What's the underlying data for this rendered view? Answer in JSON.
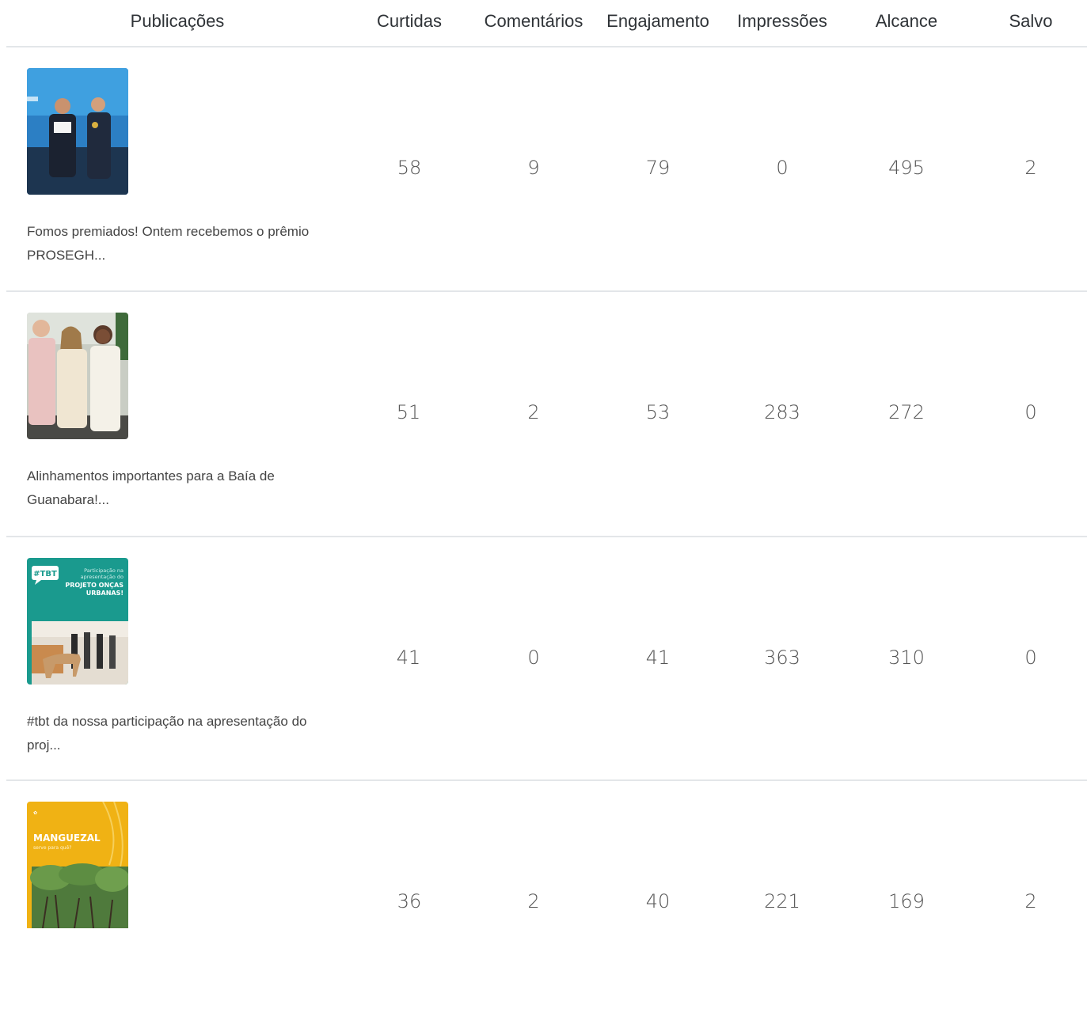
{
  "columns": [
    "Publicações",
    "Curtidas",
    "Comentários",
    "Engajamento",
    "Impressões",
    "Alcance",
    "Salvo"
  ],
  "posts": [
    {
      "thumb_icon": "award-ceremony-photo",
      "caption": "Fomos premiados! Ontem recebemos o prêmio PROSEGH...",
      "curtidas": "58",
      "comentarios": "9",
      "engajamento": "79",
      "impressoes": "0",
      "alcance": "495",
      "salvo": "2"
    },
    {
      "thumb_icon": "group-photo",
      "caption": "Alinhamentos importantes para a Baía de Guanabara!...",
      "curtidas": "51",
      "comentarios": "2",
      "engajamento": "53",
      "impressoes": "283",
      "alcance": "272",
      "salvo": "0"
    },
    {
      "thumb_icon": "tbt-poster",
      "caption": "#tbt da nossa participação na apresentação do proj...",
      "curtidas": "41",
      "comentarios": "0",
      "engajamento": "41",
      "impressoes": "363",
      "alcance": "310",
      "salvo": "0",
      "thumb_text": {
        "badge": "#TBT",
        "line1": "Participação na",
        "line2": "apresentação do",
        "line3": "PROJETO ONÇAS",
        "line4": "URBANAS!"
      }
    },
    {
      "thumb_icon": "mangrove-poster",
      "caption": "",
      "curtidas": "36",
      "comentarios": "2",
      "engajamento": "40",
      "impressoes": "221",
      "alcance": "169",
      "salvo": "2",
      "thumb_text": {
        "title": "MANGUEZAL",
        "subtitle": "serve para quê?"
      }
    }
  ],
  "colors": {
    "divider": "#e3e6e9",
    "teal": "#1a9a8e",
    "yellow": "#f0b214"
  }
}
